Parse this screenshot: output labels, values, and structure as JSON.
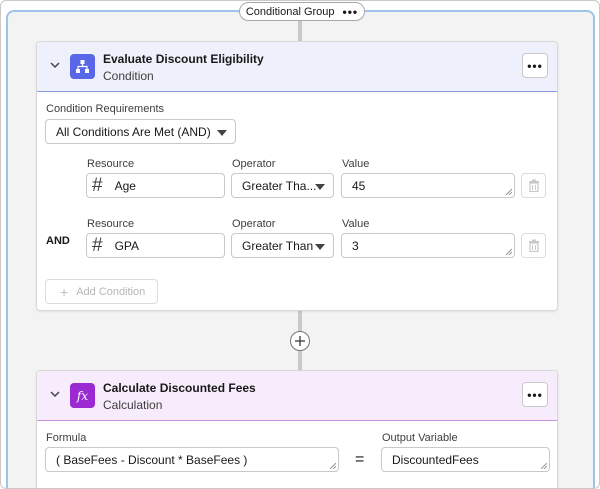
{
  "group": {
    "label": "Conditional Group",
    "menu_label": "•••"
  },
  "condition_card": {
    "title": "Evaluate Discount Eligibility",
    "subtitle": "Condition",
    "menu_label": "•••",
    "requirements_label": "Condition Requirements",
    "requirements_value": "All Conditions Are Met (AND)",
    "rows": [
      {
        "connector": "",
        "resource_label": "Resource",
        "resource_value": "Age",
        "operator_label": "Operator",
        "operator_value": "Greater Tha...",
        "value_label": "Value",
        "value": "45"
      },
      {
        "connector": "AND",
        "resource_label": "Resource",
        "resource_value": "GPA",
        "operator_label": "Operator",
        "operator_value": "Greater Than",
        "value_label": "Value",
        "value": "3"
      }
    ],
    "add_condition_label": "Add Condition"
  },
  "calc_card": {
    "title": "Calculate Discounted Fees",
    "subtitle": "Calculation",
    "menu_label": "•••",
    "formula_label": "Formula",
    "formula_value": "( BaseFees - Discount * BaseFees )",
    "equals": "=",
    "output_label": "Output Variable",
    "output_value": "DiscountedFees"
  },
  "icons": {
    "condition": "hierarchy-icon",
    "calculation": "function-icon"
  },
  "colors": {
    "condition_header_bg": "#eef1fb",
    "condition_header_border": "#8a9ae0",
    "condition_icon_bg": "#5867e8",
    "calc_header_bg": "#f7ecfb",
    "calc_header_border": "#c98fe0",
    "calc_icon_bg": "#9b2ad3",
    "group_outline": "#9ec4ea"
  }
}
